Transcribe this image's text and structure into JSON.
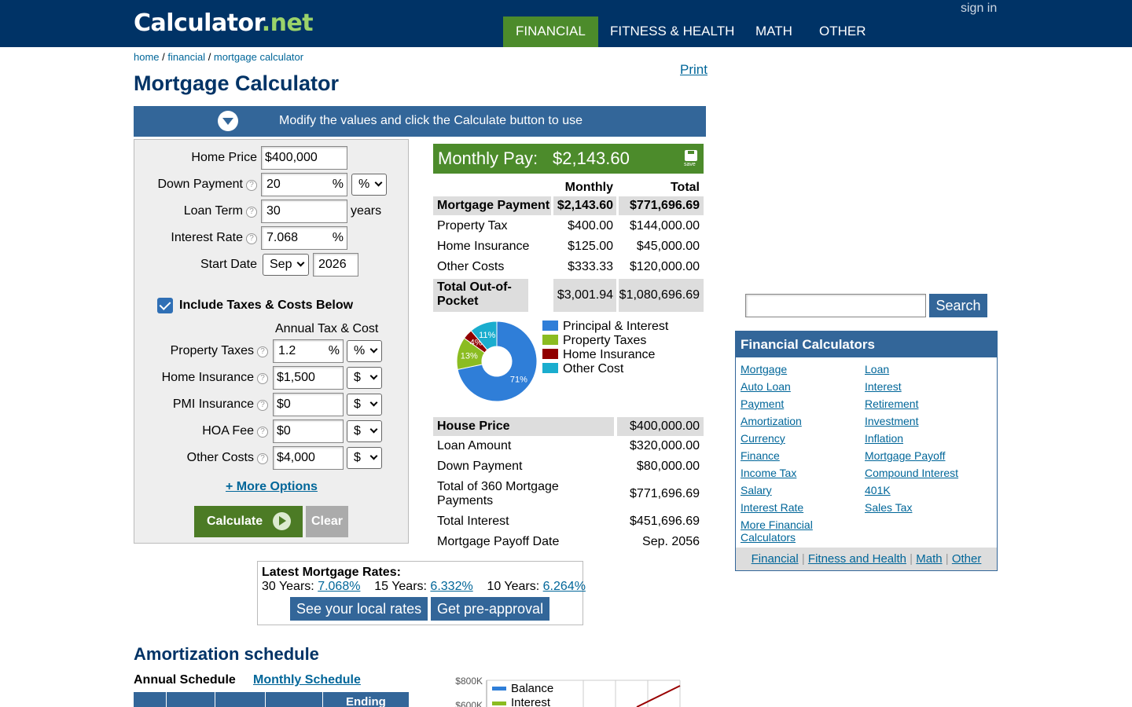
{
  "header": {
    "logo_main": "Calculator",
    "logo_dot": ".",
    "logo_net": "net",
    "sign_in": "sign in",
    "nav": [
      "FINANCIAL",
      "FITNESS & HEALTH",
      "MATH",
      "OTHER"
    ],
    "nav_active": "FINANCIAL"
  },
  "breadcrumb": [
    "home",
    "financial",
    "mortgage calculator"
  ],
  "breadcrumb_sep": " / ",
  "print": "Print",
  "title": "Mortgage Calculator",
  "instruction": "Modify the values and click the Calculate button to use",
  "form": {
    "home_price_label": "Home Price",
    "home_price": "$400,000",
    "down_payment_label": "Down Payment",
    "down_payment": "20",
    "down_payment_suffix": "%",
    "down_payment_unit": "%",
    "loan_term_label": "Loan Term",
    "loan_term": "30",
    "loan_term_unit": "years",
    "interest_rate_label": "Interest Rate",
    "interest_rate": "7.068",
    "interest_rate_suffix": "%",
    "start_date_label": "Start Date",
    "start_month": "Sep",
    "start_year": "2026",
    "include_taxes_label": "Include Taxes & Costs Below",
    "annual_label": "Annual Tax & Cost",
    "property_taxes_label": "Property Taxes",
    "property_taxes": "1.2",
    "property_taxes_suffix": "%",
    "property_taxes_unit": "%",
    "home_insurance_label": "Home Insurance",
    "home_insurance": "$1,500",
    "home_insurance_unit": "$",
    "pmi_label": "PMI Insurance",
    "pmi": "$0",
    "pmi_unit": "$",
    "hoa_label": "HOA Fee",
    "hoa": "$0",
    "hoa_unit": "$",
    "other_costs_label": "Other Costs",
    "other_costs": "$4,000",
    "other_costs_unit": "$",
    "help_glyph": "?",
    "more_options": "+ More Options",
    "calculate": "Calculate",
    "clear": "Clear"
  },
  "results": {
    "monthly_pay_label": "Monthly Pay:",
    "monthly_pay": "$2,143.60",
    "save_label": "save",
    "col_monthly": "Monthly",
    "col_total": "Total",
    "rows": [
      {
        "label": "Mortgage Payment",
        "monthly": "$2,143.60",
        "total": "$771,696.69"
      },
      {
        "label": "Property Tax",
        "monthly": "$400.00",
        "total": "$144,000.00"
      },
      {
        "label": "Home Insurance",
        "monthly": "$125.00",
        "total": "$45,000.00"
      },
      {
        "label": "Other Costs",
        "monthly": "$333.33",
        "total": "$120,000.00"
      },
      {
        "label": "Total Out-of-Pocket",
        "monthly": "$3,001.94",
        "total": "$1,080,696.69"
      }
    ],
    "pie": [
      {
        "label": "Principal & Interest",
        "pct": 71,
        "color": "#2f7ed8"
      },
      {
        "label": "Property Taxes",
        "pct": 13,
        "color": "#8bbc21"
      },
      {
        "label": "Home Insurance",
        "pct": 4,
        "color": "#910000"
      },
      {
        "label": "Other Cost",
        "pct": 11,
        "color": "#1aadce"
      }
    ],
    "summary": [
      {
        "label": "House Price",
        "value": "$400,000.00"
      },
      {
        "label": "Loan Amount",
        "value": "$320,000.00"
      },
      {
        "label": "Down Payment",
        "value": "$80,000.00"
      },
      {
        "label": "Total of 360 Mortgage Payments",
        "value": "$771,696.69"
      },
      {
        "label": "Total Interest",
        "value": "$451,696.69"
      },
      {
        "label": "Mortgage Payoff Date",
        "value": "Sep. 2056"
      }
    ]
  },
  "rates": {
    "heading": "Latest Mortgage Rates:",
    "items": [
      {
        "label": "30 Years:",
        "value": "7.068%"
      },
      {
        "label": "15 Years:",
        "value": "6.332%"
      },
      {
        "label": "10 Years:",
        "value": "6.264%"
      }
    ],
    "local_rates": "See your local rates",
    "preapproval": "Get pre-approval"
  },
  "amortization": {
    "title": "Amortization schedule",
    "annual": "Annual Schedule",
    "monthly": "Monthly Schedule",
    "ending_header": "Ending",
    "chart": {
      "ticks": [
        "$800K",
        "$600K"
      ],
      "legend": [
        {
          "name": "Balance",
          "color": "#2f7ed8"
        },
        {
          "name": "Interest",
          "color": "#8bbc21"
        }
      ],
      "line_color": "#990000"
    }
  },
  "search": {
    "button": "Search",
    "value": ""
  },
  "financial_calculators": {
    "heading": "Financial Calculators",
    "left": [
      "Mortgage",
      "Auto Loan",
      "Payment",
      "Amortization",
      "Currency",
      "Finance",
      "Income Tax",
      "Salary",
      "Interest Rate",
      "More Financial Calculators"
    ],
    "right": [
      "Loan",
      "Interest",
      "Retirement",
      "Investment",
      "Inflation",
      "Mortgage Payoff",
      "Compound Interest",
      "401K",
      "Sales Tax"
    ],
    "footer": [
      "Financial",
      "Fitness and Health",
      "Math",
      "Other"
    ],
    "footer_sep": "|"
  }
}
